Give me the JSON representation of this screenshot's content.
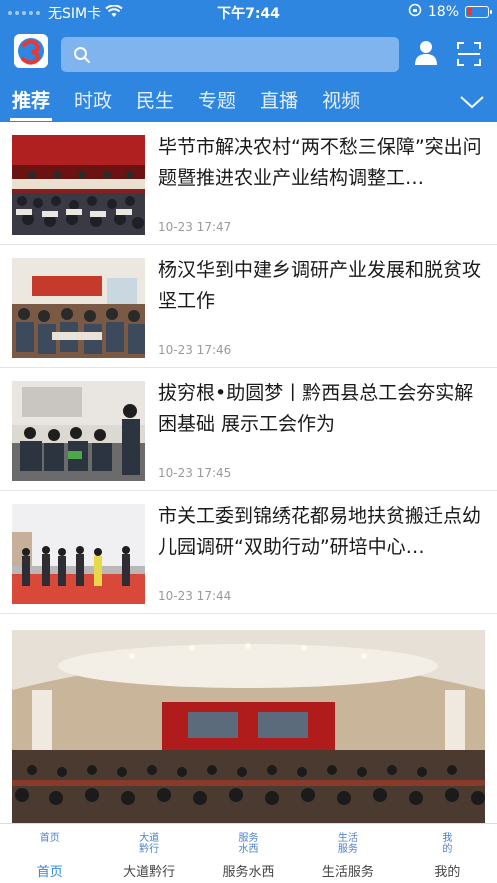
{
  "status_bar": {
    "carrier": "无SIM卡",
    "time": "下午7:44",
    "battery": "18%"
  },
  "header": {
    "search_placeholder": ""
  },
  "tabs": [
    {
      "label": "推荐",
      "active": true
    },
    {
      "label": "时政",
      "active": false
    },
    {
      "label": "民生",
      "active": false
    },
    {
      "label": "专题",
      "active": false
    },
    {
      "label": "直播",
      "active": false
    },
    {
      "label": "视频",
      "active": false
    }
  ],
  "news": [
    {
      "title": "毕节市解决农村“两不愁三保障”突出问题暨推进农业产业结构调整工…",
      "time": "10-23 17:47"
    },
    {
      "title": "杨汉华到中建乡调研产业发展和脱贫攻坚工作",
      "time": "10-23 17:46"
    },
    {
      "title": "拔穷根•助圆梦丨黔西县总工会夯实解困基础 展示工会作为",
      "time": "10-23 17:45"
    },
    {
      "title": "市关工委到锦绣花都易地扶贫搬迁点幼儿园调研“双助行动”研培中心…",
      "time": "10-23 17:44"
    }
  ],
  "tabbar": [
    {
      "icon_text": "首页",
      "label": "首页",
      "active": true
    },
    {
      "icon_text": "大道黔行",
      "label": "大道黔行",
      "active": false
    },
    {
      "icon_text": "服务水西",
      "label": "服务水西",
      "active": false
    },
    {
      "icon_text": "生活服务",
      "label": "生活服务",
      "active": false
    },
    {
      "icon_text": "我的",
      "label": "我的",
      "active": false
    }
  ],
  "colors": {
    "brand": "#2f86e0",
    "tab_active_text": "#2f86e0"
  }
}
